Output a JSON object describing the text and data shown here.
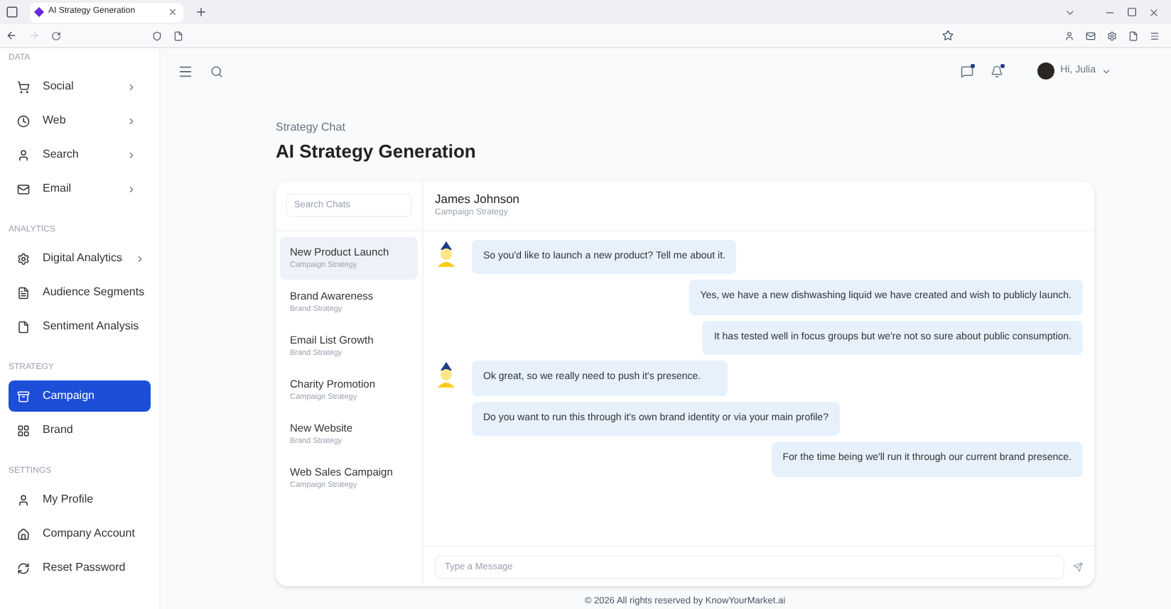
{
  "browser": {
    "tab_title": "AI Strategy Generation"
  },
  "sidebar": {
    "sections": [
      {
        "heading": "DATA",
        "items": [
          {
            "label": "Social",
            "expandable": true,
            "selected": false
          },
          {
            "label": "Web",
            "expandable": true,
            "selected": false
          },
          {
            "label": "Search",
            "expandable": true,
            "selected": false
          },
          {
            "label": "Email",
            "expandable": true,
            "selected": false
          }
        ]
      },
      {
        "heading": "ANALYTICS",
        "items": [
          {
            "label": "Digital Analytics",
            "expandable": true,
            "selected": false
          },
          {
            "label": "Audience Segments",
            "expandable": false,
            "selected": false
          },
          {
            "label": "Sentiment Analysis",
            "expandable": false,
            "selected": false
          }
        ]
      },
      {
        "heading": "STRATEGY",
        "items": [
          {
            "label": "Campaign",
            "expandable": false,
            "selected": true
          },
          {
            "label": "Brand",
            "expandable": false,
            "selected": false
          }
        ]
      },
      {
        "heading": "SETTINGS",
        "items": [
          {
            "label": "My Profile",
            "expandable": false,
            "selected": false
          },
          {
            "label": "Company Account",
            "expandable": false,
            "selected": false
          },
          {
            "label": "Reset Password",
            "expandable": false,
            "selected": false
          }
        ]
      }
    ]
  },
  "header": {
    "greeting": "Hi, Julia",
    "messages_unread": true,
    "notifications_unread": true
  },
  "page": {
    "breadcrumb": "Strategy Chat",
    "title": "AI Strategy Generation"
  },
  "chat_list": {
    "search_placeholder": "Search Chats",
    "items": [
      {
        "title": "New Product Launch",
        "subtitle": "Campaign Strategy",
        "selected": true
      },
      {
        "title": "Brand Awareness",
        "subtitle": "Brand Strategy",
        "selected": false
      },
      {
        "title": "Email List Growth",
        "subtitle": "Brand Strategy",
        "selected": false
      },
      {
        "title": "Charity Promotion",
        "subtitle": "Campaign Strategy",
        "selected": false
      },
      {
        "title": "New Website",
        "subtitle": "Brand Strategy",
        "selected": false
      },
      {
        "title": "Web Sales Campaign",
        "subtitle": "Campaign Strategy",
        "selected": false
      }
    ]
  },
  "conversation": {
    "name": "James Johnson",
    "subtitle": "Campaign Strategy",
    "message_placeholder": "Type a Message",
    "messages": [
      {
        "kind": "incoming",
        "texts": [
          "So you'd like to launch a new product? Tell me about it."
        ]
      },
      {
        "kind": "outgoing",
        "texts": [
          "Yes, we have a new dishwashing liquid we have created and wish to publicly launch.",
          "It has tested well in focus groups but we're not so sure about public consumption."
        ]
      },
      {
        "kind": "incoming",
        "texts": [
          "Ok great, so we really need to push it's presence.",
          "Do you want to run this through it's own brand identity or via your main profile?"
        ]
      },
      {
        "kind": "outgoing",
        "texts": [
          "For the time being we'll run it through our current brand presence."
        ]
      }
    ]
  },
  "footer": "© 2026 All rights reserved by KnowYourMarket.ai"
}
